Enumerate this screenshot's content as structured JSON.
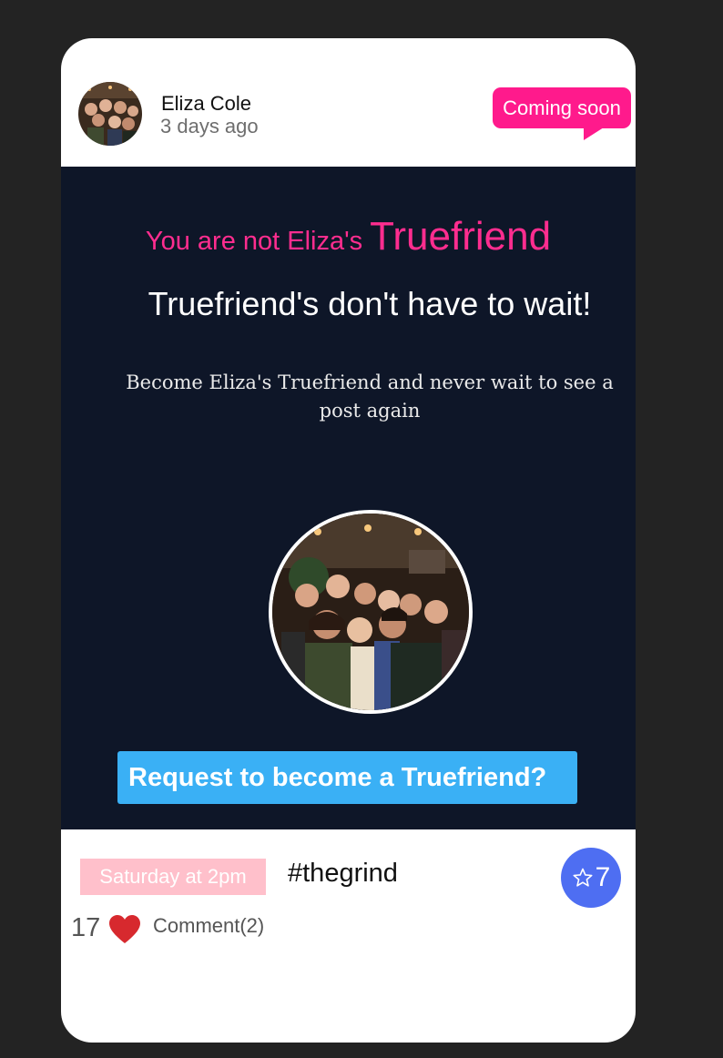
{
  "post": {
    "author": "Eliza Cole",
    "time": "3 days ago",
    "badge": "Coming soon"
  },
  "gate": {
    "not_friend_prefix": "You are not Eliza's",
    "truefriend_word": "Truefriend",
    "headline": "Truefriend's don't have to wait!",
    "subtext": "Become Eliza's Truefriend and never wait to see a post again",
    "request_button": "Request to become a Truefriend?"
  },
  "footer": {
    "event_time": "Saturday at 2pm",
    "hashtag": "#thegrind",
    "stars": "7",
    "likes": "17",
    "comments": "Comment(2)"
  },
  "colors": {
    "page_background": "#232323",
    "gate_background": "#0e1628",
    "accent_pink": "#ff1a8c",
    "button_blue": "#3ab0f5",
    "star_badge": "#4e6ef2",
    "heart_red": "#d7292e",
    "event_pink": "#ffc0cb"
  },
  "icons": {
    "star": "star-outline-icon",
    "heart": "heart-icon"
  }
}
